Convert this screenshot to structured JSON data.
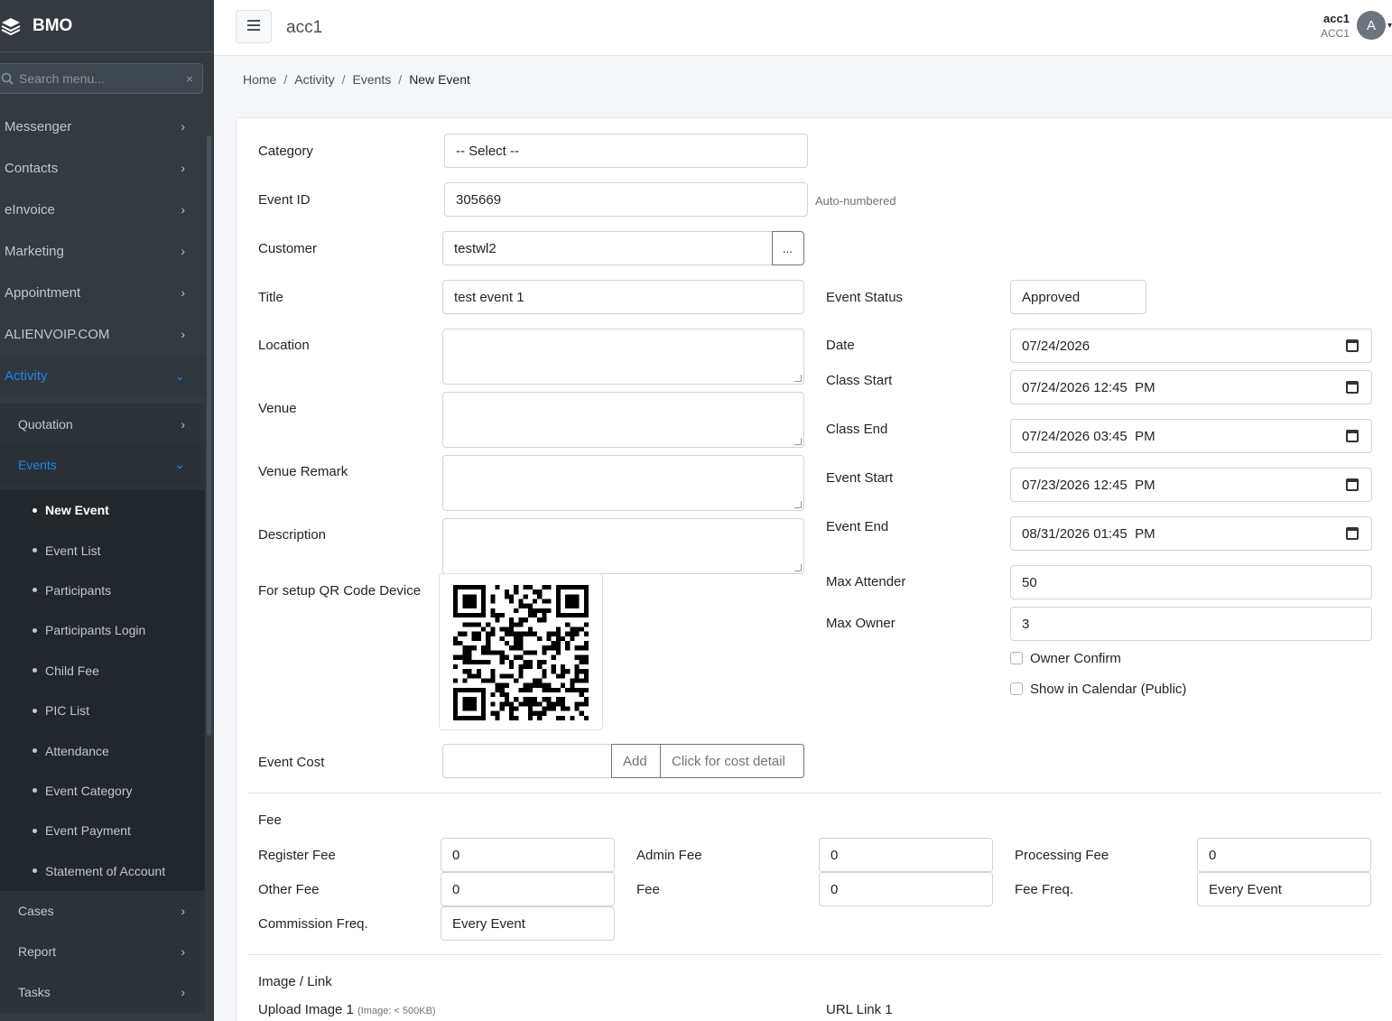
{
  "brand": {
    "name": "BMO",
    "logo_icon": "layers-icon"
  },
  "search": {
    "placeholder": "Search menu...",
    "clear": "×"
  },
  "nav": {
    "messenger": "Messenger",
    "contacts": "Contacts",
    "einvoice": "eInvoice",
    "marketing": "Marketing",
    "appointment": "Appointment",
    "alienvoip": "ALIENVOIP.COM",
    "activity": "Activity",
    "quotation": "Quotation",
    "events": "Events",
    "leaves": [
      "New Event",
      "Event List",
      "Participants",
      "Participants Login",
      "Child Fee",
      "PIC List",
      "Attendance",
      "Event Category",
      "Event Payment",
      "Statement of Account"
    ],
    "cases": "Cases",
    "report": "Report",
    "tasks": "Tasks"
  },
  "topbar": {
    "title": "acc1",
    "user_name": "acc1",
    "user_account": "ACC1",
    "avatar_letter": "A"
  },
  "breadcrumb": {
    "home": "Home",
    "activity": "Activity",
    "events": "Events",
    "current": "New Event",
    "sep": "/"
  },
  "form": {
    "category_label": "Category",
    "category_value": "-- Select --",
    "event_id_label": "Event ID",
    "event_id_value": "305669",
    "event_id_hint": "Auto-numbered",
    "customer_label": "Customer",
    "customer_value": "testwl2",
    "customer_btn": "...",
    "title_label": "Title",
    "title_value": "test event 1",
    "location_label": "Location",
    "venue_label": "Venue",
    "venue_remark_label": "Venue Remark",
    "description_label": "Description",
    "qr_label": "For setup QR Code Device",
    "event_cost_label": "Event Cost",
    "add_btn": "Add",
    "cost_detail_btn": "Click for cost detail",
    "event_status_label": "Event Status",
    "event_status_value": "Approved",
    "date_label": "Date",
    "date_value": "07/24/2026",
    "class_start_label": "Class Start",
    "class_start_value": "07/24/2026 12:45  PM",
    "class_end_label": "Class End",
    "class_end_value": "07/24/2026 03:45  PM",
    "event_start_label": "Event Start",
    "event_start_value": "07/23/2026 12:45  PM",
    "event_end_label": "Event End",
    "event_end_value": "08/31/2026 01:45  PM",
    "max_attender_label": "Max Attender",
    "max_attender_value": "50",
    "max_owner_label": "Max Owner",
    "max_owner_value": "3",
    "owner_confirm_label": "Owner Confirm",
    "show_calendar_label": "Show in Calendar (Public)"
  },
  "fee": {
    "section_title": "Fee",
    "register_fee_label": "Register Fee",
    "register_fee_value": "0",
    "admin_fee_label": "Admin Fee",
    "admin_fee_value": "0",
    "processing_fee_label": "Processing Fee",
    "processing_fee_value": "0",
    "other_fee_label": "Other Fee",
    "other_fee_value": "0",
    "fee_label": "Fee",
    "fee_value": "0",
    "fee_freq_label": "Fee Freq.",
    "fee_freq_value": "Every Event",
    "commission_freq_label": "Commission Freq.",
    "commission_freq_value": "Every Event"
  },
  "image_link": {
    "section_title": "Image / Link",
    "upload_label": "Upload Image 1",
    "upload_hint": "(Image: < 500KB)",
    "url_label": "URL Link 1"
  }
}
